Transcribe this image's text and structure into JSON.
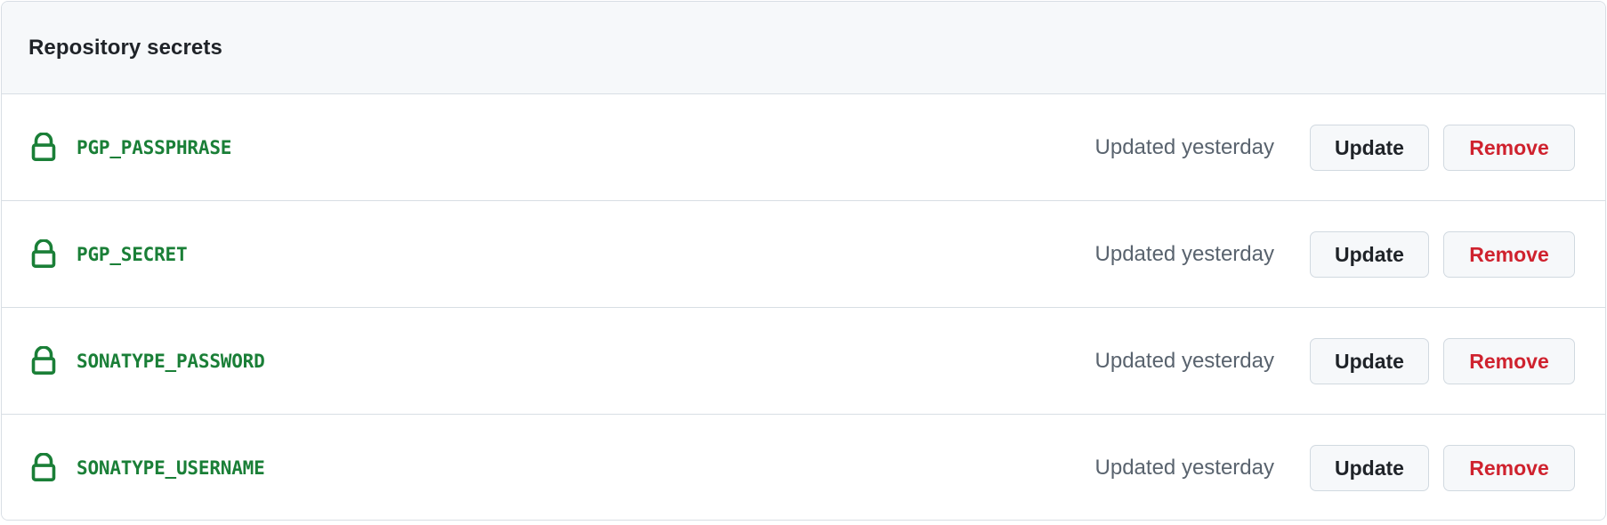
{
  "card": {
    "header_title": "Repository secrets"
  },
  "colors": {
    "secret_name": "#1a7f37",
    "lock_icon": "#1a7f37",
    "remove_label": "#cf222e",
    "update_label": "#1f2328",
    "header_background": "#f6f8fa",
    "border": "#d8dee4",
    "timestamp": "#59636e"
  },
  "actions": {
    "update_label": "Update",
    "remove_label": "Remove"
  },
  "icons": {
    "lock": "lock-icon"
  },
  "secrets": [
    {
      "name": "PGP_PASSPHRASE",
      "updated": "Updated yesterday"
    },
    {
      "name": "PGP_SECRET",
      "updated": "Updated yesterday"
    },
    {
      "name": "SONATYPE_PASSWORD",
      "updated": "Updated yesterday"
    },
    {
      "name": "SONATYPE_USERNAME",
      "updated": "Updated yesterday"
    }
  ]
}
